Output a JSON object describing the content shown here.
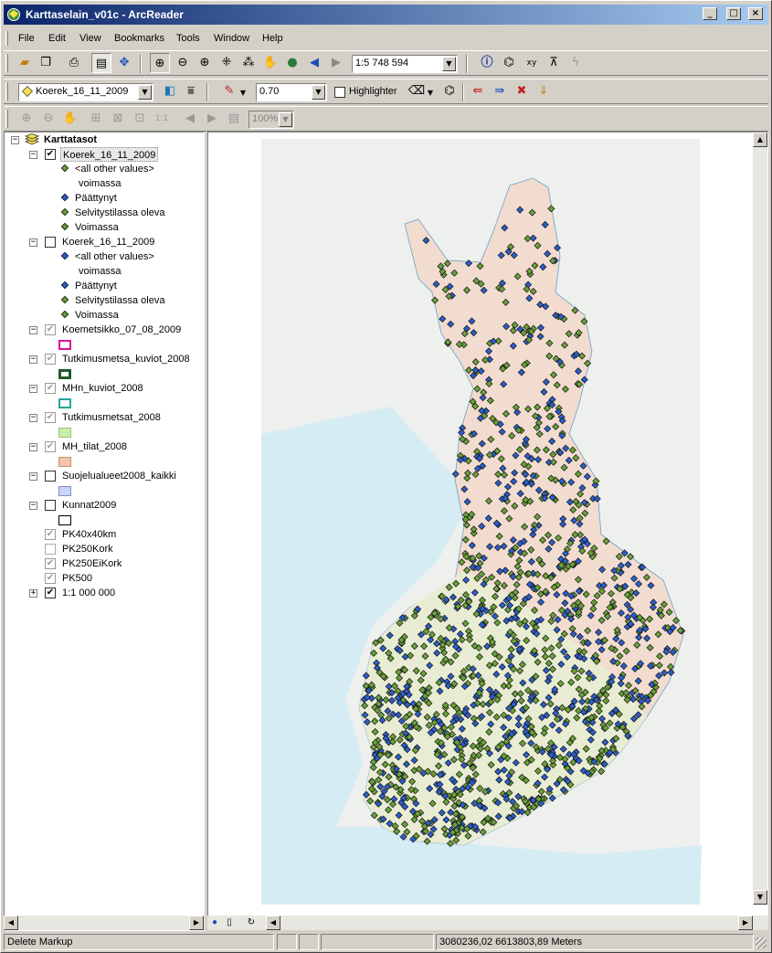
{
  "window": {
    "title": "Karttaselain_v01c - ArcReader",
    "caption_buttons": {
      "minimize": "_",
      "maximize": "□",
      "close": "×"
    }
  },
  "menu": [
    "File",
    "Edit",
    "View",
    "Bookmarks",
    "Tools",
    "Window",
    "Help"
  ],
  "toolbar1": {
    "scale": "1:5 748 594"
  },
  "toolbar2": {
    "layer_select": "Koerek_16_11_2009",
    "line_width": "0.70",
    "highlighter_label": "Highlighter"
  },
  "toolbar3": {
    "zoom_percent": "100%"
  },
  "toc": {
    "root": "Karttatasot",
    "layer1": {
      "name": "Koerek_16_11_2009",
      "items": [
        "<all other values>",
        "voimassa",
        "Päättynyt",
        "Selvitystilassa oleva",
        "Voimassa"
      ]
    },
    "layer2": {
      "name": "Koerek_16_11_2009",
      "items": [
        "<all other values>",
        "voimassa",
        "Päättynyt",
        "Selvitystilassa oleva",
        "Voimassa"
      ]
    },
    "layers": [
      {
        "name": "Koemetsikko_07_08_2009"
      },
      {
        "name": "Tutkimusmetsa_kuviot_2008"
      },
      {
        "name": "MHn_kuviot_2008"
      },
      {
        "name": "Tutkimusmetsat_2008"
      },
      {
        "name": "MH_tilat_2008"
      },
      {
        "name": "Suojelualueet2008_kaikki"
      },
      {
        "name": "Kunnat2009"
      }
    ],
    "plain": [
      "PK40x40km",
      "PK250Kork",
      "PK250EiKork",
      "PK500",
      "1:1 000 000"
    ]
  },
  "colors": {
    "green_marker": "#6aa03a",
    "blue_marker": "#2d5ec8",
    "koemetsikko": "#e0109a",
    "tutkimusmetsa_kuviot": "#1f5a2e",
    "mhn_kuviot": "#21a79a",
    "tutkimusmetsat": "#c8f0a8",
    "mh_tilat": "#f4c3a8",
    "suojelualueet": "#c8d4f8",
    "kunnat": "#000000"
  },
  "status": {
    "message": "Delete Markup",
    "coordinates": "3080236,02  6613803,89 Meters"
  }
}
